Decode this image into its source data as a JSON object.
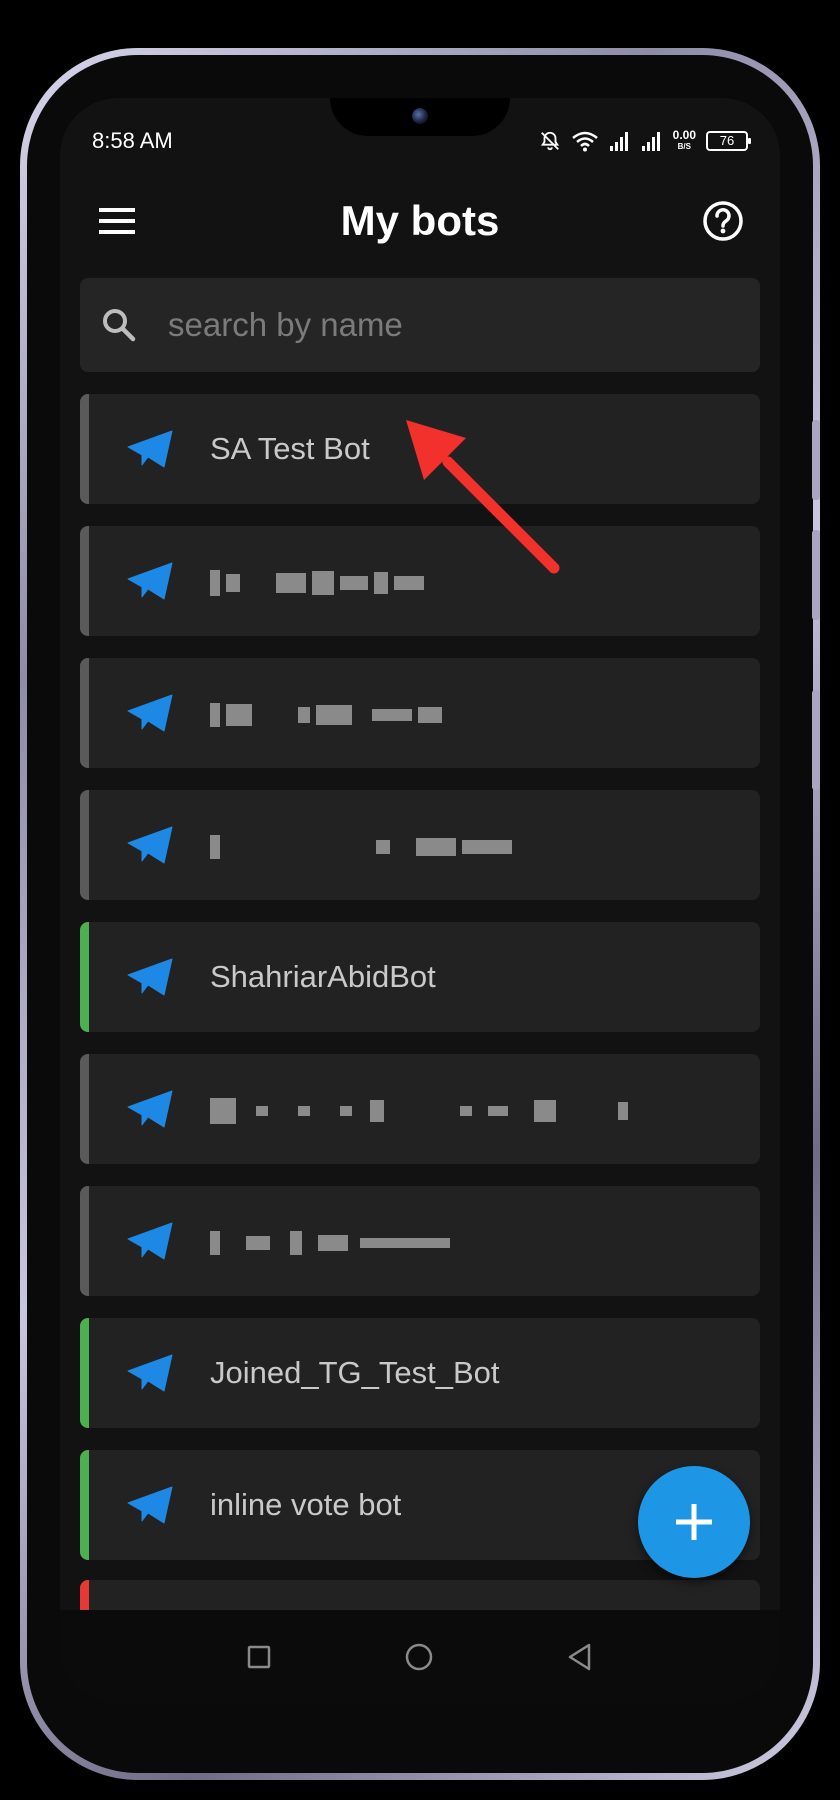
{
  "status_bar": {
    "time": "8:58 AM",
    "net_speed": "0.00",
    "net_unit": "B/S",
    "battery": "76"
  },
  "app_bar": {
    "title": "My bots",
    "menu_icon": "hamburger-menu-icon",
    "help_icon": "help-circle-icon"
  },
  "search": {
    "placeholder": "search by name",
    "icon": "search-icon"
  },
  "bots": [
    {
      "name": "SA Test Bot",
      "status_color": "#5a5a5a",
      "redacted": false
    },
    {
      "name": "",
      "status_color": "#5a5a5a",
      "redacted": true
    },
    {
      "name": "",
      "status_color": "#5a5a5a",
      "redacted": true
    },
    {
      "name": "",
      "status_color": "#5a5a5a",
      "redacted": true
    },
    {
      "name": "ShahriarAbidBot",
      "status_color": "#4caf50",
      "redacted": false
    },
    {
      "name": "",
      "status_color": "#5a5a5a",
      "redacted": true
    },
    {
      "name": "",
      "status_color": "#5a5a5a",
      "redacted": true
    },
    {
      "name": "Joined_TG_Test_Bot",
      "status_color": "#4caf50",
      "redacted": false
    },
    {
      "name": "inline vote bot",
      "status_color": "#4caf50",
      "redacted": false
    }
  ],
  "partial_item": {
    "status_color": "#e53935"
  },
  "fab": {
    "icon": "plus-icon"
  },
  "nav": {
    "recent_icon": "square-recents-icon",
    "home_icon": "circle-home-icon",
    "back_icon": "triangle-back-icon"
  },
  "colors": {
    "accent": "#1e96e6",
    "plane": "#1e88e5",
    "active": "#4caf50",
    "inactive": "#5a5a5a",
    "error": "#e53935"
  }
}
